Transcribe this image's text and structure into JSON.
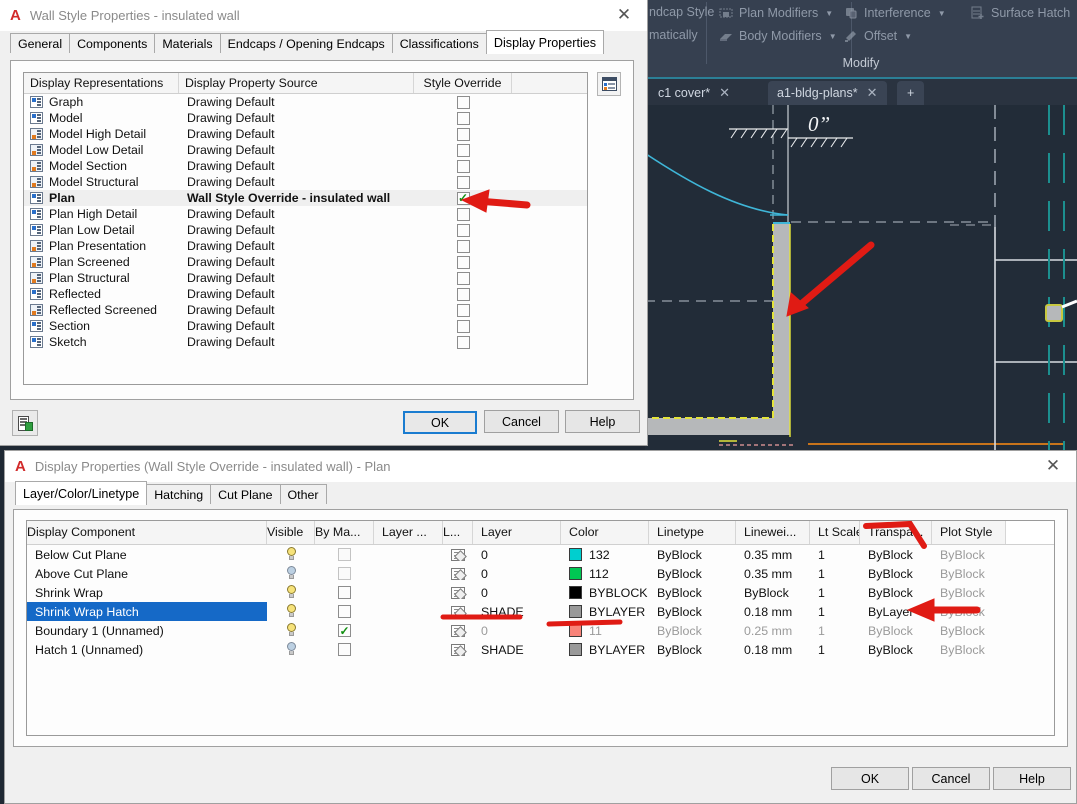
{
  "cad": {
    "ribbon": {
      "group_label": "Modify",
      "items": [
        {
          "label": "ndcap Style",
          "icon": "endcap-style-icon",
          "caret": false
        },
        {
          "label": "matically",
          "icon": "auto-icon",
          "caret": false
        },
        {
          "label": "Plan Modifiers",
          "icon": "plan-modifiers-icon",
          "caret": true
        },
        {
          "label": "Body Modifiers",
          "icon": "body-modifiers-icon",
          "caret": true
        },
        {
          "label": "Interference",
          "icon": "interference-icon",
          "caret": true
        },
        {
          "label": "Offset",
          "icon": "offset-icon",
          "caret": true
        },
        {
          "label": "Surface Hatch",
          "icon": "surface-hatch-icon",
          "caret": true
        }
      ]
    },
    "tabs": [
      {
        "label": "c1 cover*",
        "close": "✕",
        "active": false
      },
      {
        "label": "a1-bldg-plans*",
        "close": "✕",
        "active": true
      }
    ],
    "new_tab_label": "+",
    "canvas": {
      "dimension_text": "0”"
    }
  },
  "wall_style_dialog": {
    "app_glyph": "A",
    "title": "Wall Style Properties - insulated wall",
    "close_glyph": "✕",
    "tabs": [
      {
        "label": "General",
        "active": false
      },
      {
        "label": "Components",
        "active": false
      },
      {
        "label": "Materials",
        "active": false
      },
      {
        "label": "Endcaps / Opening Endcaps",
        "active": false
      },
      {
        "label": "Classifications",
        "active": false
      },
      {
        "label": "Display Properties",
        "active": true
      }
    ],
    "columns": {
      "representations": "Display Representations",
      "source": "Display Property Source",
      "override": "Style Override"
    },
    "rows": [
      {
        "name": "Graph",
        "source": "Drawing Default",
        "override": false,
        "selected": false,
        "icon": "display-rep-icon"
      },
      {
        "name": "Model",
        "source": "Drawing Default",
        "override": false,
        "selected": false,
        "icon": "display-rep-icon"
      },
      {
        "name": "Model High Detail",
        "source": "Drawing Default",
        "override": false,
        "selected": false,
        "icon": "display-rep-detail-icon"
      },
      {
        "name": "Model Low Detail",
        "source": "Drawing Default",
        "override": false,
        "selected": false,
        "icon": "display-rep-detail-icon"
      },
      {
        "name": "Model Section",
        "source": "Drawing Default",
        "override": false,
        "selected": false,
        "icon": "display-rep-detail-icon"
      },
      {
        "name": "Model Structural",
        "source": "Drawing Default",
        "override": false,
        "selected": false,
        "icon": "display-rep-detail-icon"
      },
      {
        "name": "Plan",
        "source": "Wall Style Override - insulated wall",
        "override": true,
        "selected": true,
        "icon": "display-rep-icon"
      },
      {
        "name": "Plan High Detail",
        "source": "Drawing Default",
        "override": false,
        "selected": false,
        "icon": "display-rep-icon"
      },
      {
        "name": "Plan Low Detail",
        "source": "Drawing Default",
        "override": false,
        "selected": false,
        "icon": "display-rep-icon"
      },
      {
        "name": "Plan Presentation",
        "source": "Drawing Default",
        "override": false,
        "selected": false,
        "icon": "display-rep-detail-icon"
      },
      {
        "name": "Plan Screened",
        "source": "Drawing Default",
        "override": false,
        "selected": false,
        "icon": "display-rep-detail-icon"
      },
      {
        "name": "Plan Structural",
        "source": "Drawing Default",
        "override": false,
        "selected": false,
        "icon": "display-rep-detail-icon"
      },
      {
        "name": "Reflected",
        "source": "Drawing Default",
        "override": false,
        "selected": false,
        "icon": "display-rep-icon"
      },
      {
        "name": "Reflected Screened",
        "source": "Drawing Default",
        "override": false,
        "selected": false,
        "icon": "display-rep-detail-icon"
      },
      {
        "name": "Section",
        "source": "Drawing Default",
        "override": false,
        "selected": false,
        "icon": "display-rep-icon"
      },
      {
        "name": "Sketch",
        "source": "Drawing Default",
        "override": false,
        "selected": false,
        "icon": "display-rep-icon"
      }
    ],
    "buttons": {
      "ok": "OK",
      "cancel": "Cancel",
      "help": "Help"
    }
  },
  "display_properties_dialog": {
    "app_glyph": "A",
    "title": "Display Properties (Wall Style Override - insulated wall) - Plan",
    "close_glyph": "✕",
    "tabs": [
      {
        "label": "Layer/Color/Linetype",
        "active": true
      },
      {
        "label": "Hatching",
        "active": false
      },
      {
        "label": "Cut Plane",
        "active": false
      },
      {
        "label": "Other",
        "active": false
      }
    ],
    "columns": [
      "Display Component",
      "Visible",
      "By Ma...",
      "Layer ...",
      "L...",
      "Layer",
      "Color",
      "Linetype",
      "Linewei...",
      "Lt Scale",
      "Transpa...",
      "Plot Style"
    ],
    "rows": [
      {
        "component": "Below Cut Plane",
        "visible": "on",
        "by_material": false,
        "by_material_disabled": true,
        "layer": "0",
        "color": "132",
        "color_hex": "#00cfcf",
        "linetype": "ByBlock",
        "lineweight": "0.35 mm",
        "lt_scale": "1",
        "transparency": "ByBlock",
        "plot_style": "ByBlock",
        "selected": false,
        "dim": false
      },
      {
        "component": "Above Cut Plane",
        "visible": "off",
        "by_material": false,
        "by_material_disabled": true,
        "layer": "0",
        "color": "112",
        "color_hex": "#00c853",
        "linetype": "ByBlock",
        "lineweight": "0.35 mm",
        "lt_scale": "1",
        "transparency": "ByBlock",
        "plot_style": "ByBlock",
        "selected": false,
        "dim": false
      },
      {
        "component": "Shrink Wrap",
        "visible": "on",
        "by_material": false,
        "by_material_disabled": false,
        "layer": "0",
        "color": "BYBLOCK",
        "color_hex": "#000000",
        "linetype": "ByBlock",
        "lineweight": "ByBlock",
        "lt_scale": "1",
        "transparency": "ByBlock",
        "plot_style": "ByBlock",
        "selected": false,
        "dim": false
      },
      {
        "component": "Shrink Wrap Hatch",
        "visible": "on",
        "by_material": false,
        "by_material_disabled": false,
        "layer": "SHADE",
        "color": "BYLAYER",
        "color_hex": "#999999",
        "linetype": "ByBlock",
        "lineweight": "0.18 mm",
        "lt_scale": "1",
        "transparency": "ByLayer",
        "plot_style": "ByBlock",
        "selected": true,
        "dim": false
      },
      {
        "component": "Boundary 1 (Unnamed)",
        "visible": "on",
        "by_material": true,
        "by_material_disabled": false,
        "layer": "0",
        "color": "11",
        "color_hex": "#f88379",
        "linetype": "ByBlock",
        "lineweight": "0.25 mm",
        "lt_scale": "1",
        "transparency": "ByBlock",
        "plot_style": "ByBlock",
        "selected": false,
        "dim": true
      },
      {
        "component": "Hatch 1 (Unnamed)",
        "visible": "off",
        "by_material": false,
        "by_material_disabled": false,
        "layer": "SHADE",
        "color": "BYLAYER",
        "color_hex": "#999999",
        "linetype": "ByBlock",
        "lineweight": "0.18 mm",
        "lt_scale": "1",
        "transparency": "ByBlock",
        "plot_style": "ByBlock",
        "selected": false,
        "dim": false
      }
    ],
    "buttons": {
      "ok": "OK",
      "cancel": "Cancel",
      "help": "Help"
    }
  },
  "annotations": {
    "color": "#e01b14",
    "arrows": [
      {
        "name": "arrow-style-override-checkbox"
      },
      {
        "name": "arrow-wall-in-drawing"
      },
      {
        "name": "arrow-transparency-bylayer"
      }
    ],
    "underlines": [
      {
        "name": "underline-shade-layer"
      },
      {
        "name": "underline-bylayer-color"
      },
      {
        "name": "underline-transparency-header"
      }
    ]
  }
}
